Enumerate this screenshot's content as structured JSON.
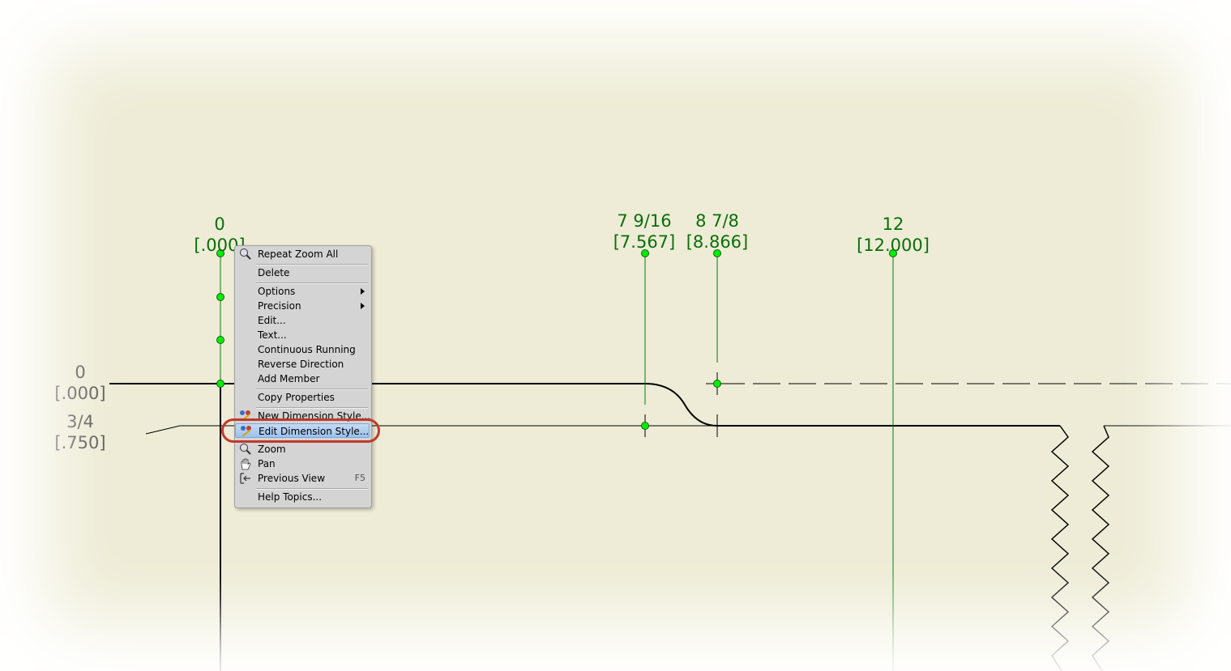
{
  "dimensions": {
    "top": [
      {
        "value": "0",
        "metric": "[.000]"
      },
      {
        "value": "7 9/16",
        "metric": "[7.567]"
      },
      {
        "value": "8 7/8",
        "metric": "[8.866]"
      },
      {
        "value": "12",
        "metric": "[12.000]"
      }
    ],
    "left": [
      {
        "value": "0",
        "metric": "[.000]"
      },
      {
        "value": "3/4",
        "metric": "[.750]"
      }
    ]
  },
  "context_menu": {
    "repeat_zoom_all": "Repeat Zoom All",
    "delete": "Delete",
    "options": "Options",
    "precision": "Precision",
    "edit": "Edit...",
    "text": "Text...",
    "continuous_running": "Continuous Running",
    "reverse_direction": "Reverse Direction",
    "add_member": "Add Member",
    "copy_properties": "Copy Properties",
    "new_dimension_style": "New Dimension Style...",
    "edit_dimension_style": "Edit Dimension Style...",
    "zoom": "Zoom",
    "pan": "Pan",
    "previous_view": "Previous View",
    "previous_view_shortcut": "F5",
    "help_topics": "Help Topics..."
  },
  "colors": {
    "canvas": "#eeecd6",
    "dimension_green": "#0a6e0a",
    "grip_green": "#00ee00",
    "highlight_ring": "#c0392b"
  }
}
